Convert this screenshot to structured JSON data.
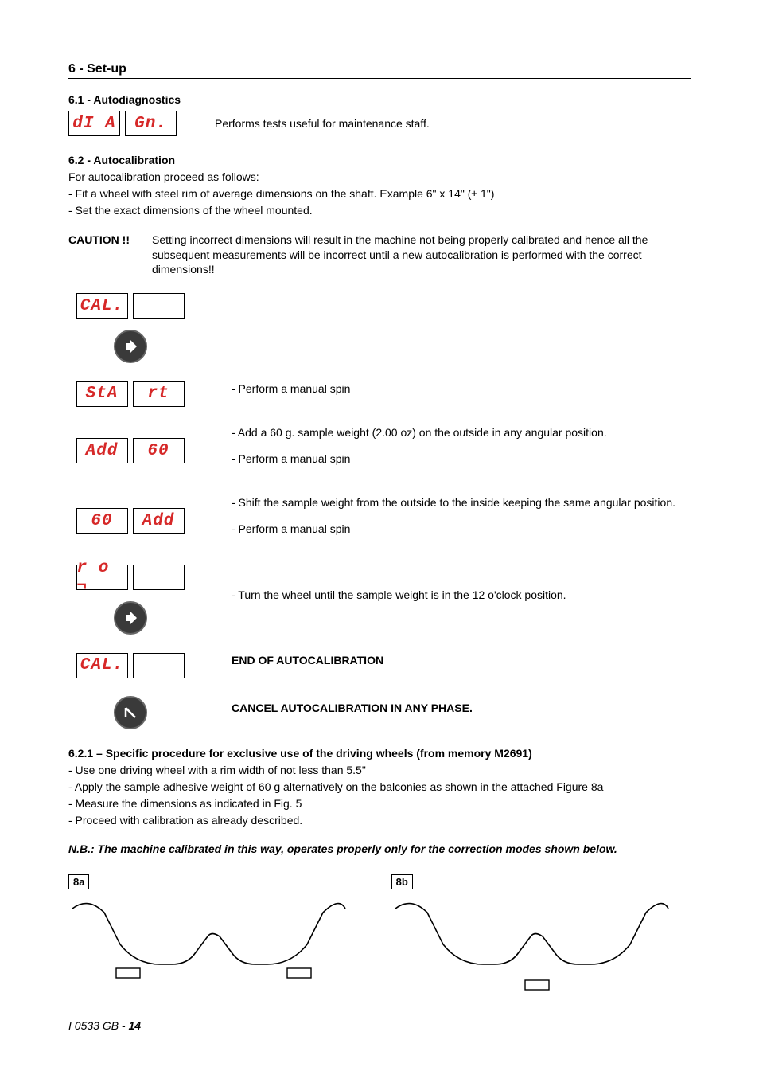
{
  "section_title": "6 - Set-up",
  "s61": {
    "title": "6.1 - Autodiagnostics",
    "disp_left": "dI A",
    "disp_right": "Gn.",
    "desc": "Performs tests useful for maintenance staff."
  },
  "s62": {
    "title": "6.2 - Autocalibration",
    "intro": [
      "For autocalibration proceed as follows:",
      "- Fit a wheel with steel rim of average dimensions on the shaft. Example 6\" x 14\" (± 1\")",
      "- Set the exact dimensions of the wheel mounted."
    ],
    "caution_label": "CAUTION !!",
    "caution_text": "Setting incorrect dimensions will result in the machine not being properly calibrated and hence all the subsequent measurements will be incorrect until a new autocalibration is performed with the correct dimensions!!",
    "steps": [
      {
        "left": "CAL.",
        "right": "",
        "icon_after": "go",
        "text": []
      },
      {
        "left": "StA",
        "right": "rt",
        "text": [
          "- Perform a manual spin"
        ]
      },
      {
        "left": "Add",
        "right": "60",
        "text": [
          "- Add a 60 g. sample weight (2.00 oz) on the outside in any angular position.",
          "- Perform a manual spin"
        ]
      },
      {
        "left": "60",
        "right": "Add",
        "text": [
          "- Shift the sample weight from the outside to the inside keeping the same angular position.",
          "- Perform a manual spin"
        ]
      },
      {
        "left": "r o ¬",
        "right": "",
        "icon_after": "go",
        "text": [
          "- Turn the wheel until the sample weight is in the 12 o'clock position."
        ]
      },
      {
        "left": "CAL.",
        "right": "",
        "text_bold": "END OF AUTOCALIBRATION"
      },
      {
        "icon_only": "back",
        "text_bold": "CANCEL AUTOCALIBRATION IN ANY PHASE."
      }
    ]
  },
  "s621": {
    "title": "6.2.1 – Specific procedure for exclusive use of the driving wheels (from memory M2691)",
    "items": [
      "- Use one driving wheel with a rim width of not less than 5.5\"",
      "- Apply the sample adhesive weight of 60 g alternatively on the balconies as shown in the attached Figure 8a",
      "- Measure the dimensions as indicated in Fig. 5",
      "- Proceed with calibration as already described."
    ]
  },
  "nb": "N.B.: The machine calibrated in this way, operates properly only for the correction modes shown below.",
  "figs": {
    "a": "8a",
    "b": "8b"
  },
  "footer": {
    "doc": "I 0533 GB - ",
    "page": "14"
  }
}
